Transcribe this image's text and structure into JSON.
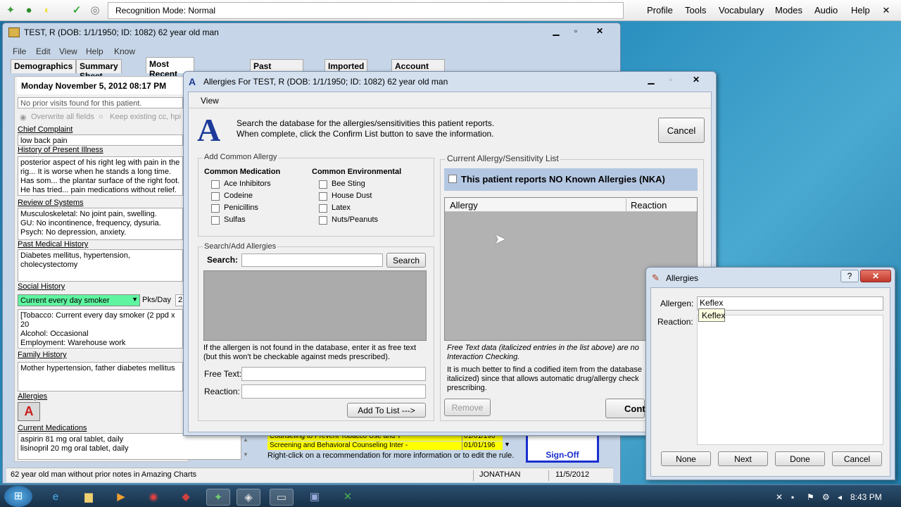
{
  "toolbar": {
    "recognition_label": "Recognition Mode: Normal",
    "menus": [
      "Profile",
      "Tools",
      "Vocabulary",
      "Modes",
      "Audio",
      "Help"
    ]
  },
  "main_window": {
    "title": "TEST, R (DOB: 1/1/1950; ID: 1082) 62 year old man",
    "menu": [
      "File",
      "Edit",
      "View",
      "Help",
      "Know"
    ],
    "tabs": [
      "Demographics",
      "Summary Sheet",
      "Most Recent Encounter",
      "Past Encounters",
      "Imported Items",
      "Account Information"
    ],
    "date_header": "Monday November 5, 2012   08:17 PM",
    "prior_visits": "No prior visits found for this patient.",
    "overwrite_label": "Overwrite all fields",
    "keep_label": "Keep existing cc, hpi",
    "chief_complaint_label": "Chief Complaint",
    "chief_complaint": "low back pain",
    "hpi_label": "History of Present Illness",
    "hpi": "posterior aspect of his right leg with pain in the rig... It is worse when he stands a long time.  Has som... the plantar surface of the right foot.  He has tried... pain medications without relief.",
    "ros_label": "Review of Systems",
    "ros": [
      "Musculoskeletal: No joint pain, swelling.",
      "GU: No incontinence, frequency, dysuria.",
      "Psych: No depression, anxiety."
    ],
    "pmh_label": "Past Medical History",
    "pmh": "Diabetes mellitus, hypertension, cholecystectomy",
    "social_label": "Social History",
    "smoker_select": "Current every day smoker",
    "pks_label": "Pks/Day",
    "pks_value": "2",
    "social_text": [
      "[Tobacco: Current every day smoker (2 ppd x 20",
      "Alcohol: Occasional",
      "Employment: Warehouse work"
    ],
    "family_label": "Family History",
    "family": "Mother hypertension, father diabetes mellitus",
    "allergies_label": "Allergies",
    "meds_label": "Current Medications",
    "meds": [
      "aspirin 81 mg oral tablet, daily",
      "lisinopril 20 mg oral tablet, daily"
    ],
    "recommendations": [
      {
        "text": "Counseling to Prevent Tobacco Use and T",
        "date": "01/01/196"
      },
      {
        "text": "Screening and Behavioral Counseling Inter -",
        "date": "01/01/196"
      }
    ],
    "recommend_hint": "Right-click on a recommendation for more information or to edit the rule.",
    "signoff_label": "Sign-Off",
    "status_left": "62 year old man without prior notes in Amazing Charts",
    "status_user": "JONATHAN",
    "status_date": "11/5/2012"
  },
  "allergy_dialog": {
    "title": "Allergies For TEST, R  (DOB: 1/1/1950; ID: 1082) 62 year old man",
    "menu_view": "View",
    "instructions": [
      "Search the database for the allergies/sensitivities this patient reports.",
      "When complete, click the Confirm List button to save the information."
    ],
    "cancel_label": "Cancel",
    "add_common_label": "Add Common Allergy",
    "common_med_label": "Common Medication",
    "common_env_label": "Common Environmental",
    "medications": [
      "Ace Inhibitors",
      "Codeine",
      "Penicillins",
      "Sulfas"
    ],
    "environmental": [
      "Bee Sting",
      "House Dust",
      "Latex",
      "Nuts/Peanuts"
    ],
    "search_group_label": "Search/Add Allergies",
    "search_label": "Search:",
    "search_button": "Search",
    "free_text_note": [
      "If the allergen is not found in the database, enter it as free text",
      "(but this won't be checkable against meds prescribed)."
    ],
    "free_text_label": "Free Text:",
    "reaction_label": "Reaction:",
    "add_to_list_button": "Add To List --->",
    "current_list_label": "Current Allergy/Sensitivity List",
    "nka_label": "This patient reports NO Known Allergies (NKA)",
    "col_allergy": "Allergy",
    "col_reaction": "Reaction",
    "italic_note": [
      "Free Text data (italicized entries in the list above) are no",
      "Interaction Checking."
    ],
    "better_note": [
      "It is much better to find a codified item from the database",
      "italicized) since that allows automatic drug/allergy check",
      "prescribing."
    ],
    "remove_button": "Remove",
    "confirm_button": "Cont"
  },
  "small_dialog": {
    "title": "Allergies",
    "help_glyph": "?",
    "close_glyph": "✕",
    "allergen_label": "Allergen:",
    "allergen_value": "Keflex",
    "suggestion": "Keflex",
    "reaction_label": "Reaction:",
    "buttons": [
      "None",
      "Next",
      "Done",
      "Cancel"
    ]
  },
  "taskbar": {
    "clock": "8:43 PM"
  }
}
